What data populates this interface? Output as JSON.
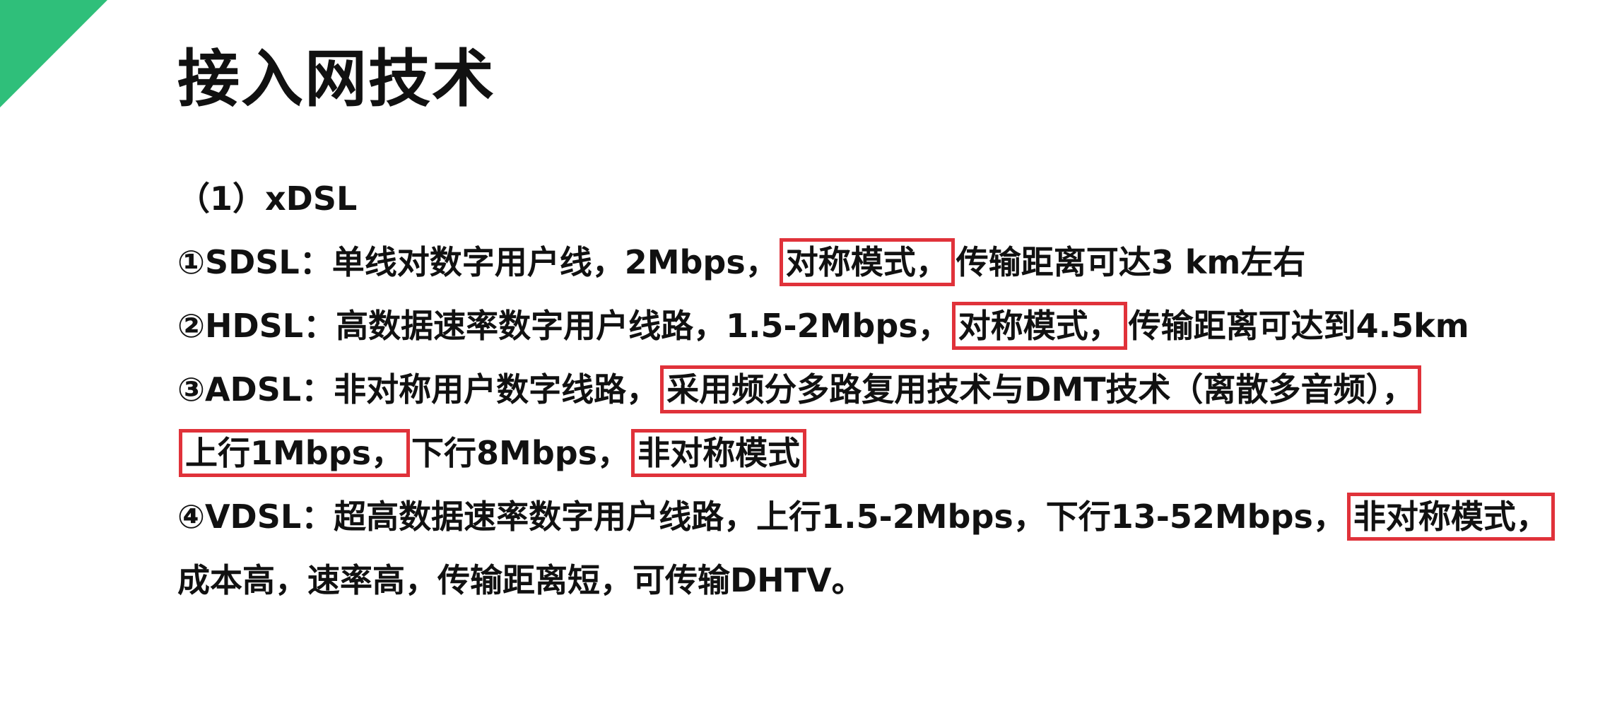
{
  "slide": {
    "title": "接入网技术",
    "accent_color": "#2fbf7a",
    "highlight_color": "#e0323a",
    "lines": [
      {
        "segments": [
          {
            "text": "（1）xDSL",
            "highlight": false
          }
        ]
      },
      {
        "segments": [
          {
            "text": "①SDSL：单线对数字用户线，2Mbps，",
            "highlight": false
          },
          {
            "text": "对称模式，",
            "highlight": true
          },
          {
            "text": "传输距离可达3 km左右",
            "highlight": false
          }
        ]
      },
      {
        "segments": [
          {
            "text": "②HDSL：高数据速率数字用户线路，1.5-2Mbps，",
            "highlight": false
          },
          {
            "text": "对称模式，",
            "highlight": true
          },
          {
            "text": "传输距离可达到4.5km",
            "highlight": false
          }
        ]
      },
      {
        "segments": [
          {
            "text": "③ADSL：非对称用户数字线路，",
            "highlight": false
          },
          {
            "text": "采用频分多路复用技术与DMT技术（离散多音频），",
            "highlight": true
          }
        ]
      },
      {
        "segments": [
          {
            "text": "上行1Mbps，",
            "highlight": true
          },
          {
            "text": "下行8Mbps，",
            "highlight": false
          },
          {
            "text": "非对称模式",
            "highlight": true
          }
        ]
      },
      {
        "segments": [
          {
            "text": "④VDSL：超高数据速率数字用户线路，上行1.5-2Mbps，下行13-52Mbps，",
            "highlight": false
          },
          {
            "text": "非对称模式，",
            "highlight": true
          }
        ]
      },
      {
        "segments": [
          {
            "text": "成本高，速率高，传输距离短，可传输DHTV。",
            "highlight": false
          }
        ]
      }
    ]
  }
}
